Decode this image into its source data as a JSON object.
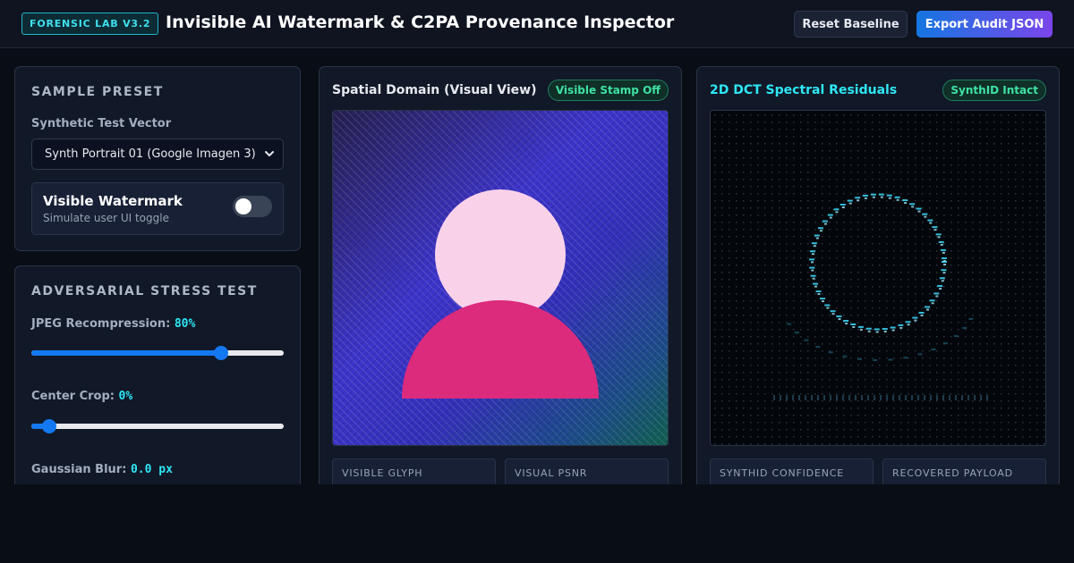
{
  "header": {
    "badge": "FORENSIC LAB V3.2",
    "title": "Invisible AI Watermark & C2PA Provenance Inspector",
    "reset_label": "Reset Baseline",
    "export_label": "Export Audit JSON"
  },
  "sample_preset": {
    "title": "SAMPLE PRESET",
    "vector_label": "Synthetic Test Vector",
    "vector_value": "Synth Portrait 01 (Google Imagen 3)",
    "toggle_title": "Visible Watermark",
    "toggle_subtitle": "Simulate user UI toggle",
    "toggle_on": false
  },
  "stress_test": {
    "title": "ADVERSARIAL STRESS TEST",
    "jpeg_label": "JPEG Recompression:",
    "jpeg_value": "80%",
    "jpeg_level": 0.75,
    "crop_label": "Center Crop:",
    "crop_value": "0%",
    "crop_level": 0.07,
    "blur_label": "Gaussian Blur:",
    "blur_value": "0.0 px"
  },
  "spatial": {
    "title": "Spatial Domain (Visual View)",
    "status": "Visible Stamp Off",
    "metric1_label": "VISIBLE GLYPH",
    "metric2_label": "VISUAL PSNR"
  },
  "spectral": {
    "title": "2D DCT Spectral Residuals",
    "status": "SynthID Intact",
    "metric1_label": "SYNTHID CONFIDENCE",
    "metric2_label": "RECOVERED PAYLOAD"
  },
  "colors": {
    "accent_cyan": "#2ee6f5",
    "status_green": "#3fe1a3",
    "brand_blue": "#1576e0",
    "brand_purple": "#7b45ea",
    "body_pink": "#dc2a7d",
    "head_pink": "#f9d2ea"
  },
  "icons": {
    "select_arrow": "chevron-down-icon"
  }
}
